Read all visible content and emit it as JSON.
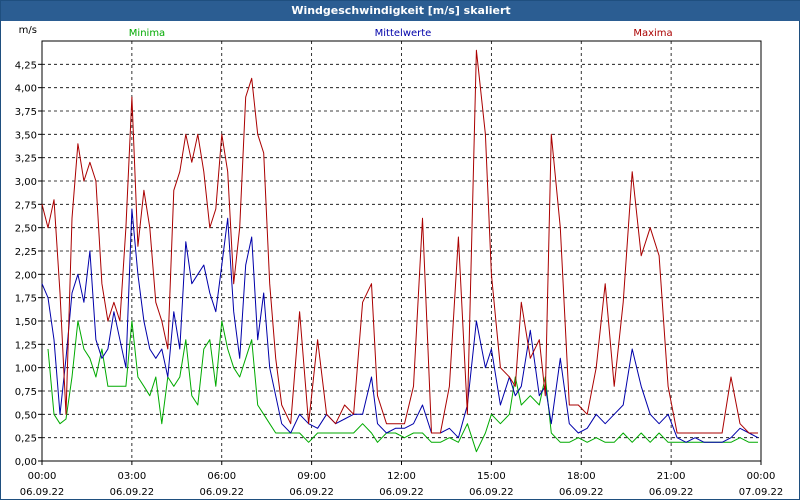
{
  "window": {
    "title": "Windgeschwindigkeit [m/s] skaliert"
  },
  "colors": {
    "min": "#00aa00",
    "mean": "#0000aa",
    "max": "#aa0000",
    "frame": "#2b5d92"
  },
  "chart_data": {
    "type": "line",
    "ylabel": "m/s",
    "ylim": [
      0,
      4.5
    ],
    "yticks": [
      "0,00",
      "0,25",
      "0,50",
      "0,75",
      "1,00",
      "1,25",
      "1,50",
      "1,75",
      "2,00",
      "2,25",
      "2,50",
      "2,75",
      "3,00",
      "3,25",
      "3,50",
      "3,75",
      "4,00",
      "4,25"
    ],
    "xlim": [
      0,
      24
    ],
    "xticks": [
      {
        "time": "00:00",
        "date": "06.09.22"
      },
      {
        "time": "03:00",
        "date": "06.09.22"
      },
      {
        "time": "06:00",
        "date": "06.09.22"
      },
      {
        "time": "09:00",
        "date": "06.09.22"
      },
      {
        "time": "12:00",
        "date": "06.09.22"
      },
      {
        "time": "15:00",
        "date": "06.09.22"
      },
      {
        "time": "18:00",
        "date": "06.09.22"
      },
      {
        "time": "21:00",
        "date": "06.09.22"
      },
      {
        "time": "00:00",
        "date": "07.09.22"
      }
    ],
    "grid": true,
    "series": [
      {
        "name": "Minima",
        "color": "#00aa00",
        "points": [
          [
            0.2,
            1.2
          ],
          [
            0.4,
            0.5
          ],
          [
            0.6,
            0.4
          ],
          [
            0.8,
            0.45
          ],
          [
            1.0,
            0.9
          ],
          [
            1.2,
            1.5
          ],
          [
            1.4,
            1.2
          ],
          [
            1.6,
            1.1
          ],
          [
            1.8,
            0.9
          ],
          [
            2.0,
            1.2
          ],
          [
            2.2,
            0.8
          ],
          [
            2.4,
            0.8
          ],
          [
            2.6,
            0.8
          ],
          [
            2.8,
            0.8
          ],
          [
            3.0,
            1.5
          ],
          [
            3.2,
            0.9
          ],
          [
            3.4,
            0.8
          ],
          [
            3.6,
            0.7
          ],
          [
            3.8,
            0.9
          ],
          [
            4.0,
            0.4
          ],
          [
            4.2,
            0.9
          ],
          [
            4.4,
            0.8
          ],
          [
            4.6,
            0.9
          ],
          [
            4.8,
            1.3
          ],
          [
            5.0,
            0.7
          ],
          [
            5.2,
            0.6
          ],
          [
            5.4,
            1.2
          ],
          [
            5.6,
            1.3
          ],
          [
            5.8,
            0.8
          ],
          [
            6.0,
            1.5
          ],
          [
            6.2,
            1.2
          ],
          [
            6.4,
            1.0
          ],
          [
            6.6,
            0.9
          ],
          [
            6.8,
            1.1
          ],
          [
            7.0,
            1.3
          ],
          [
            7.2,
            0.6
          ],
          [
            7.4,
            0.5
          ],
          [
            7.6,
            0.4
          ],
          [
            7.8,
            0.3
          ],
          [
            8.0,
            0.3
          ],
          [
            8.3,
            0.3
          ],
          [
            8.6,
            0.3
          ],
          [
            8.9,
            0.2
          ],
          [
            9.2,
            0.3
          ],
          [
            9.5,
            0.3
          ],
          [
            9.8,
            0.3
          ],
          [
            10.1,
            0.3
          ],
          [
            10.4,
            0.3
          ],
          [
            10.7,
            0.4
          ],
          [
            11.0,
            0.3
          ],
          [
            11.2,
            0.2
          ],
          [
            11.5,
            0.3
          ],
          [
            11.8,
            0.3
          ],
          [
            12.1,
            0.25
          ],
          [
            12.4,
            0.3
          ],
          [
            12.7,
            0.3
          ],
          [
            13.0,
            0.2
          ],
          [
            13.3,
            0.2
          ],
          [
            13.6,
            0.25
          ],
          [
            13.9,
            0.2
          ],
          [
            14.2,
            0.4
          ],
          [
            14.5,
            0.1
          ],
          [
            14.8,
            0.3
          ],
          [
            15.0,
            0.5
          ],
          [
            15.3,
            0.4
          ],
          [
            15.6,
            0.5
          ],
          [
            15.8,
            0.9
          ],
          [
            16.0,
            0.6
          ],
          [
            16.3,
            0.7
          ],
          [
            16.6,
            0.6
          ],
          [
            16.8,
            0.9
          ],
          [
            17.0,
            0.3
          ],
          [
            17.3,
            0.2
          ],
          [
            17.6,
            0.2
          ],
          [
            17.9,
            0.25
          ],
          [
            18.2,
            0.2
          ],
          [
            18.5,
            0.25
          ],
          [
            18.8,
            0.2
          ],
          [
            19.1,
            0.2
          ],
          [
            19.4,
            0.3
          ],
          [
            19.7,
            0.2
          ],
          [
            20.0,
            0.3
          ],
          [
            20.3,
            0.2
          ],
          [
            20.6,
            0.3
          ],
          [
            20.9,
            0.2
          ],
          [
            21.2,
            0.2
          ],
          [
            21.5,
            0.2
          ],
          [
            21.8,
            0.2
          ],
          [
            22.1,
            0.2
          ],
          [
            22.4,
            0.2
          ],
          [
            22.7,
            0.2
          ],
          [
            23.0,
            0.2
          ],
          [
            23.3,
            0.25
          ],
          [
            23.6,
            0.2
          ],
          [
            23.9,
            0.2
          ]
        ]
      },
      {
        "name": "Mittelwerte",
        "color": "#0000aa",
        "points": [
          [
            0.0,
            1.9
          ],
          [
            0.2,
            1.75
          ],
          [
            0.4,
            1.3
          ],
          [
            0.6,
            0.5
          ],
          [
            0.8,
            1.1
          ],
          [
            1.0,
            1.8
          ],
          [
            1.2,
            2.0
          ],
          [
            1.4,
            1.7
          ],
          [
            1.6,
            2.25
          ],
          [
            1.8,
            1.3
          ],
          [
            2.0,
            1.1
          ],
          [
            2.2,
            1.2
          ],
          [
            2.4,
            1.6
          ],
          [
            2.6,
            1.3
          ],
          [
            2.8,
            1.0
          ],
          [
            3.0,
            2.7
          ],
          [
            3.2,
            2.0
          ],
          [
            3.4,
            1.5
          ],
          [
            3.6,
            1.2
          ],
          [
            3.8,
            1.1
          ],
          [
            4.0,
            1.2
          ],
          [
            4.2,
            0.9
          ],
          [
            4.4,
            1.6
          ],
          [
            4.6,
            1.2
          ],
          [
            4.8,
            2.35
          ],
          [
            5.0,
            1.9
          ],
          [
            5.2,
            2.0
          ],
          [
            5.4,
            2.1
          ],
          [
            5.6,
            1.8
          ],
          [
            5.8,
            1.6
          ],
          [
            6.0,
            2.1
          ],
          [
            6.2,
            2.6
          ],
          [
            6.4,
            1.6
          ],
          [
            6.6,
            1.1
          ],
          [
            6.8,
            2.1
          ],
          [
            7.0,
            2.4
          ],
          [
            7.2,
            1.3
          ],
          [
            7.4,
            1.8
          ],
          [
            7.6,
            1.0
          ],
          [
            7.8,
            0.7
          ],
          [
            8.0,
            0.4
          ],
          [
            8.3,
            0.3
          ],
          [
            8.6,
            0.5
          ],
          [
            8.9,
            0.4
          ],
          [
            9.2,
            0.35
          ],
          [
            9.5,
            0.5
          ],
          [
            9.8,
            0.4
          ],
          [
            10.1,
            0.45
          ],
          [
            10.4,
            0.5
          ],
          [
            10.7,
            0.5
          ],
          [
            11.0,
            0.9
          ],
          [
            11.2,
            0.4
          ],
          [
            11.5,
            0.3
          ],
          [
            11.8,
            0.35
          ],
          [
            12.1,
            0.35
          ],
          [
            12.4,
            0.4
          ],
          [
            12.7,
            0.6
          ],
          [
            13.0,
            0.3
          ],
          [
            13.3,
            0.3
          ],
          [
            13.6,
            0.35
          ],
          [
            13.9,
            0.25
          ],
          [
            14.2,
            0.6
          ],
          [
            14.5,
            1.5
          ],
          [
            14.8,
            1.0
          ],
          [
            15.0,
            1.2
          ],
          [
            15.3,
            0.6
          ],
          [
            15.6,
            0.9
          ],
          [
            15.8,
            0.7
          ],
          [
            16.0,
            0.8
          ],
          [
            16.3,
            1.4
          ],
          [
            16.6,
            0.7
          ],
          [
            16.8,
            0.8
          ],
          [
            17.0,
            0.4
          ],
          [
            17.3,
            1.1
          ],
          [
            17.6,
            0.4
          ],
          [
            17.9,
            0.3
          ],
          [
            18.2,
            0.35
          ],
          [
            18.5,
            0.5
          ],
          [
            18.8,
            0.4
          ],
          [
            19.1,
            0.5
          ],
          [
            19.4,
            0.6
          ],
          [
            19.7,
            1.2
          ],
          [
            20.0,
            0.8
          ],
          [
            20.3,
            0.5
          ],
          [
            20.6,
            0.4
          ],
          [
            20.9,
            0.5
          ],
          [
            21.2,
            0.25
          ],
          [
            21.5,
            0.2
          ],
          [
            21.8,
            0.25
          ],
          [
            22.1,
            0.2
          ],
          [
            22.4,
            0.2
          ],
          [
            22.7,
            0.2
          ],
          [
            23.0,
            0.25
          ],
          [
            23.3,
            0.35
          ],
          [
            23.6,
            0.3
          ],
          [
            23.9,
            0.25
          ]
        ]
      },
      {
        "name": "Maxima",
        "color": "#aa0000",
        "points": [
          [
            0.0,
            2.75
          ],
          [
            0.2,
            2.5
          ],
          [
            0.4,
            2.8
          ],
          [
            0.6,
            1.8
          ],
          [
            0.8,
            0.5
          ],
          [
            1.0,
            2.6
          ],
          [
            1.2,
            3.4
          ],
          [
            1.4,
            3.0
          ],
          [
            1.6,
            3.2
          ],
          [
            1.8,
            3.0
          ],
          [
            2.0,
            1.9
          ],
          [
            2.2,
            1.5
          ],
          [
            2.4,
            1.7
          ],
          [
            2.6,
            1.5
          ],
          [
            2.8,
            2.5
          ],
          [
            3.0,
            3.9
          ],
          [
            3.2,
            2.3
          ],
          [
            3.4,
            2.9
          ],
          [
            3.6,
            2.5
          ],
          [
            3.8,
            1.7
          ],
          [
            4.0,
            1.5
          ],
          [
            4.2,
            1.2
          ],
          [
            4.4,
            2.9
          ],
          [
            4.6,
            3.1
          ],
          [
            4.8,
            3.5
          ],
          [
            5.0,
            3.2
          ],
          [
            5.2,
            3.5
          ],
          [
            5.4,
            3.1
          ],
          [
            5.6,
            2.5
          ],
          [
            5.8,
            2.7
          ],
          [
            6.0,
            3.5
          ],
          [
            6.2,
            3.1
          ],
          [
            6.4,
            1.9
          ],
          [
            6.6,
            2.5
          ],
          [
            6.8,
            3.9
          ],
          [
            7.0,
            4.1
          ],
          [
            7.2,
            3.5
          ],
          [
            7.4,
            3.3
          ],
          [
            7.6,
            1.9
          ],
          [
            7.8,
            1.1
          ],
          [
            8.0,
            0.6
          ],
          [
            8.3,
            0.4
          ],
          [
            8.6,
            1.6
          ],
          [
            8.9,
            0.4
          ],
          [
            9.2,
            1.3
          ],
          [
            9.5,
            0.5
          ],
          [
            9.8,
            0.4
          ],
          [
            10.1,
            0.6
          ],
          [
            10.4,
            0.5
          ],
          [
            10.7,
            1.7
          ],
          [
            11.0,
            1.9
          ],
          [
            11.2,
            0.7
          ],
          [
            11.5,
            0.4
          ],
          [
            11.8,
            0.4
          ],
          [
            12.1,
            0.4
          ],
          [
            12.4,
            0.8
          ],
          [
            12.7,
            2.6
          ],
          [
            13.0,
            0.3
          ],
          [
            13.3,
            0.3
          ],
          [
            13.6,
            0.8
          ],
          [
            13.9,
            2.4
          ],
          [
            14.2,
            0.5
          ],
          [
            14.5,
            4.4
          ],
          [
            14.8,
            3.5
          ],
          [
            15.0,
            2.0
          ],
          [
            15.3,
            1.0
          ],
          [
            15.6,
            0.9
          ],
          [
            15.8,
            0.8
          ],
          [
            16.0,
            1.7
          ],
          [
            16.3,
            1.1
          ],
          [
            16.6,
            1.3
          ],
          [
            16.8,
            0.7
          ],
          [
            17.0,
            3.5
          ],
          [
            17.3,
            2.5
          ],
          [
            17.6,
            0.6
          ],
          [
            17.9,
            0.6
          ],
          [
            18.2,
            0.5
          ],
          [
            18.5,
            1.0
          ],
          [
            18.8,
            1.9
          ],
          [
            19.1,
            0.8
          ],
          [
            19.4,
            1.7
          ],
          [
            19.7,
            3.1
          ],
          [
            20.0,
            2.2
          ],
          [
            20.3,
            2.5
          ],
          [
            20.6,
            2.2
          ],
          [
            20.9,
            0.8
          ],
          [
            21.2,
            0.3
          ],
          [
            21.5,
            0.3
          ],
          [
            21.8,
            0.3
          ],
          [
            22.1,
            0.3
          ],
          [
            22.4,
            0.3
          ],
          [
            22.7,
            0.3
          ],
          [
            23.0,
            0.9
          ],
          [
            23.3,
            0.4
          ],
          [
            23.6,
            0.3
          ],
          [
            23.9,
            0.3
          ]
        ]
      }
    ]
  }
}
